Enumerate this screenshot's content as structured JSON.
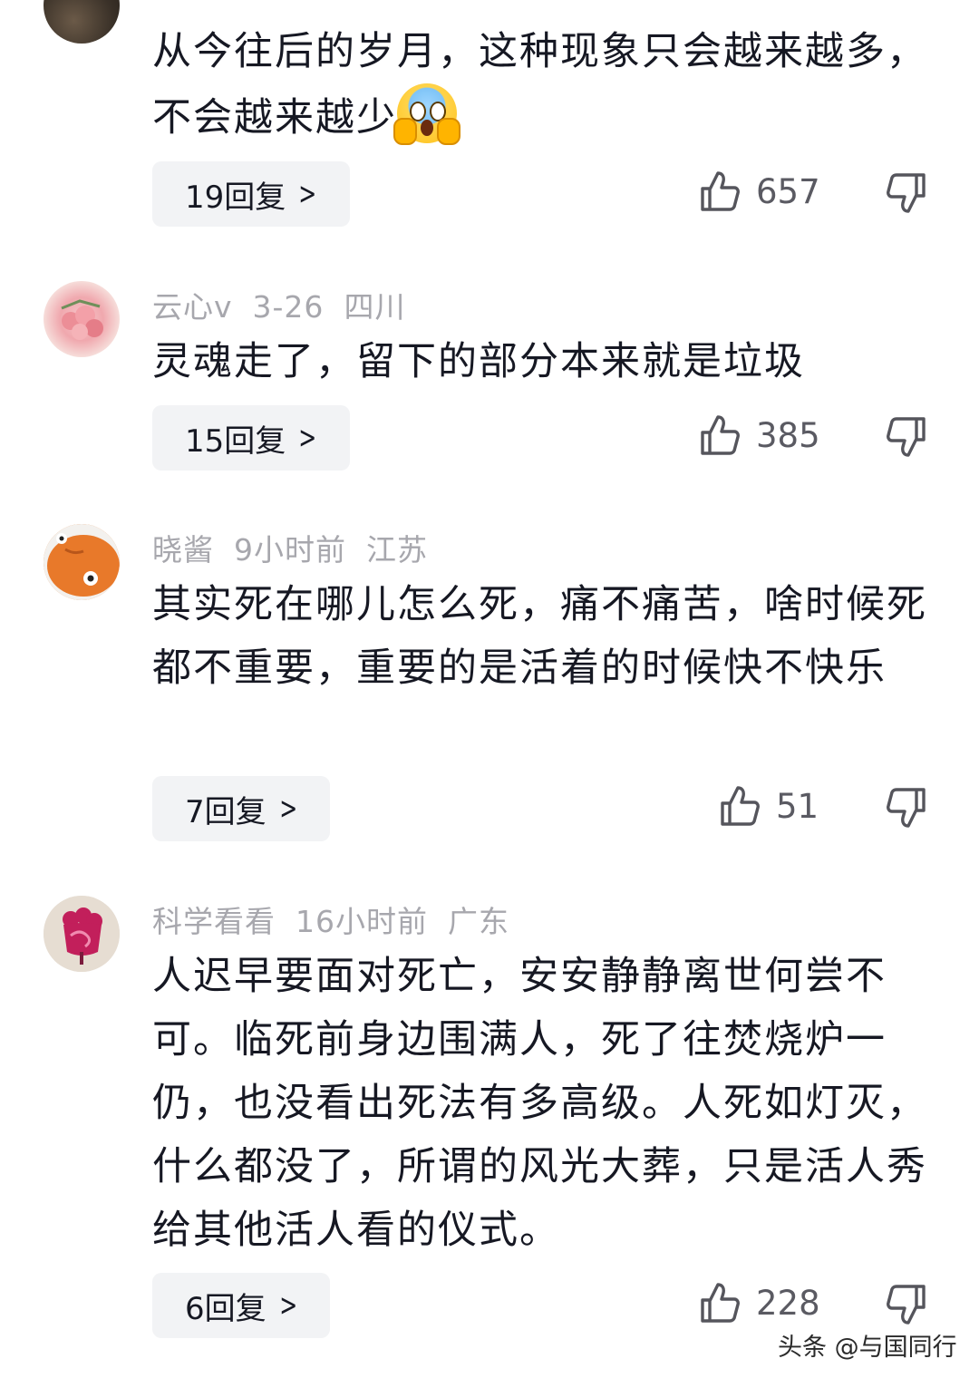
{
  "comments": [
    {
      "body": "从今往后的岁月，这种现象只会越来越多，不会越来越少",
      "emoji": "scream-emoji",
      "reply_label": "19回复",
      "likes": "657"
    },
    {
      "username": "云心v",
      "date": "3-26",
      "location": "四川",
      "body": "灵魂走了，留下的部分本来就是垃圾",
      "reply_label": "15回复",
      "likes": "385"
    },
    {
      "username": "晓酱",
      "date": "9小时前",
      "location": "江苏",
      "body": "其实死在哪儿怎么死，痛不痛苦，啥时候死都不重要，重要的是活着的时候快不快乐",
      "reply_label": "7回复",
      "likes": "51"
    },
    {
      "username": "科学看看",
      "date": "16小时前",
      "location": "广东",
      "body": "人迟早要面对死亡，安安静静离世何尝不可。临死前身边围满人，死了往焚烧炉一仍，也没看出死法有多高级。人死如灯灭，什么都没了，所谓的风光大葬，只是活人秀给其他活人看的仪式。",
      "reply_label": "6回复",
      "likes": "228"
    }
  ],
  "icons": {
    "like": "thumbs-up-icon",
    "dislike": "thumbs-down-icon",
    "chevron": "chevron-right-icon"
  },
  "watermark": "头条 @与国同行"
}
